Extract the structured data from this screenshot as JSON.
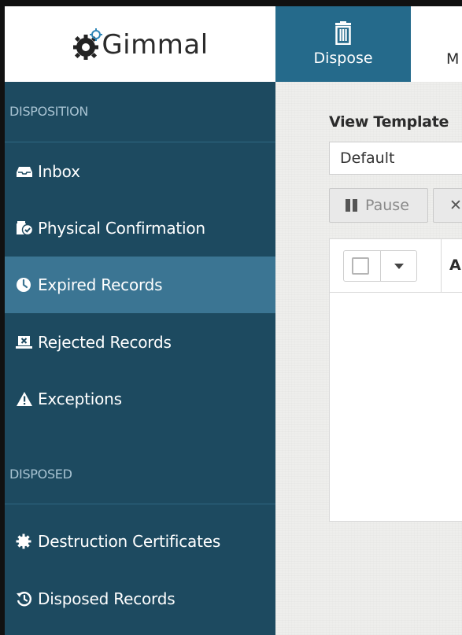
{
  "app": {
    "logo_text": "Gimmal"
  },
  "topnav": {
    "items": [
      {
        "label": "Dispose",
        "icon": "trash-icon",
        "active": true
      },
      {
        "label": "M",
        "icon": "",
        "active": false
      }
    ]
  },
  "sidebar": {
    "sections": [
      {
        "title": "DISPOSITION",
        "items": [
          {
            "label": "Inbox",
            "icon": "inbox-icon",
            "active": false
          },
          {
            "label": "Physical Confirmation",
            "icon": "box-check-icon",
            "active": false
          },
          {
            "label": "Expired Records",
            "icon": "clock-icon",
            "active": true
          },
          {
            "label": "Rejected Records",
            "icon": "rejected-box-icon",
            "active": false
          },
          {
            "label": "Exceptions",
            "icon": "warning-icon",
            "active": false
          }
        ]
      },
      {
        "title": "DISPOSED",
        "items": [
          {
            "label": "Destruction Certificates",
            "icon": "certificate-icon",
            "active": false
          },
          {
            "label": "Disposed Records",
            "icon": "history-icon",
            "active": false
          }
        ]
      }
    ]
  },
  "main": {
    "view_template_label": "View Template",
    "view_template_value": "Default",
    "toolbar": {
      "pause_label": "Pause",
      "cancel_label": "✕"
    },
    "grid": {
      "first_column_header": "A"
    }
  },
  "colors": {
    "sidebar_bg": "#1d4a60",
    "sidebar_active": "#3b7593",
    "nav_active": "#256a8b",
    "content_bg": "#eeeeec"
  }
}
